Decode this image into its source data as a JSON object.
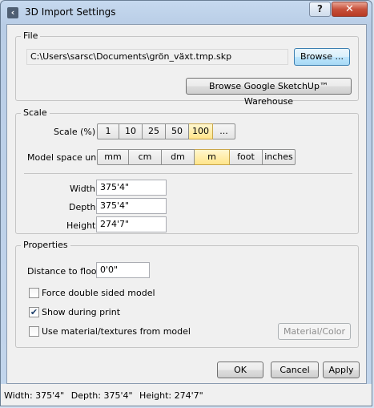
{
  "window": {
    "title": "3D Import Settings",
    "help_label": "?",
    "close_label": "✕"
  },
  "file": {
    "group_label": "File",
    "path": "C:\\Users\\sarsc\\Documents\\grön_växt.tmp.skp",
    "browse_label": "Browse ...",
    "warehouse_label": "Browse Google SketchUp™ Warehouse"
  },
  "scale": {
    "group_label": "Scale",
    "scale_label": "Scale (%)",
    "scale_options": [
      "1",
      "10",
      "25",
      "50",
      "100",
      "..."
    ],
    "scale_selected": "100",
    "unit_label": "Model space unit",
    "unit_options": [
      "mm",
      "cm",
      "dm",
      "m",
      "foot",
      "inches"
    ],
    "unit_selected": "m",
    "width_label": "Width",
    "width_value": "375'4\"",
    "depth_label": "Depth",
    "depth_value": "375'4\"",
    "height_label": "Height",
    "height_value": "274'7\""
  },
  "properties": {
    "group_label": "Properties",
    "distance_label": "Distance to floor",
    "distance_value": "0'0\"",
    "force_double_label": "Force double sided model",
    "force_double_checked": false,
    "show_print_label": "Show during print",
    "show_print_checked": true,
    "use_material_label": "Use material/textures from model",
    "use_material_checked": false,
    "material_color_label": "Material/Color"
  },
  "actions": {
    "ok_label": "OK",
    "cancel_label": "Cancel",
    "apply_label": "Apply"
  },
  "status": {
    "width": "Width: 375'4\"",
    "depth": "Depth: 375'4\"",
    "height": "Height: 274'7\""
  }
}
